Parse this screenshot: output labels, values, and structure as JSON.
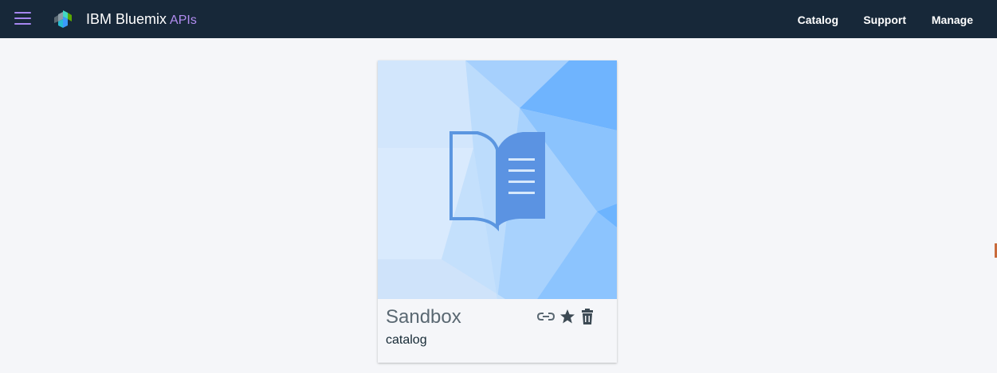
{
  "header": {
    "menu_icon": "hamburger-icon",
    "logo_icon": "bluemix-logo-icon",
    "brand_name": "IBM Bluemix",
    "brand_sub": "APIs",
    "nav": [
      "Catalog",
      "Support",
      "Manage"
    ]
  },
  "card": {
    "title": "Sandbox",
    "subtitle": "catalog",
    "art_icon": "open-book-icon",
    "actions": [
      "link-icon",
      "star-icon",
      "trash-icon"
    ]
  },
  "colors": {
    "header_bg": "#172839",
    "accent": "#a686f0",
    "page_bg": "#f5f6f9",
    "card_title": "#5a6872"
  }
}
